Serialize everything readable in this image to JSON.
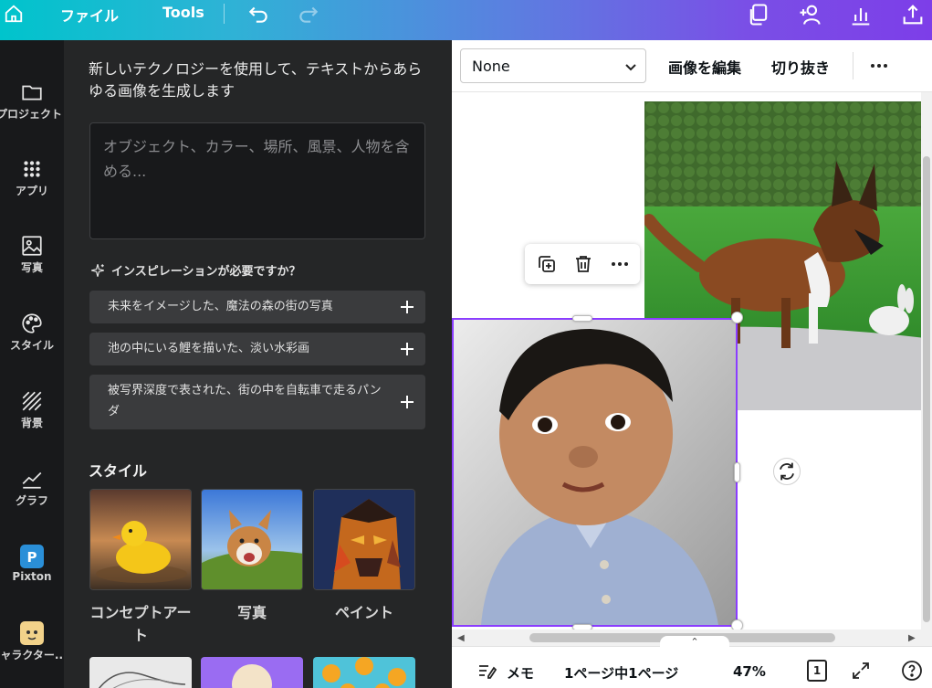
{
  "topbar": {
    "menu_file": "ファイル",
    "menu_tools": "Tools"
  },
  "rail": {
    "items": [
      {
        "label": "プロジェクト",
        "icon": "folder-icon"
      },
      {
        "label": "アプリ",
        "icon": "apps-grid-icon"
      },
      {
        "label": "写真",
        "icon": "photo-icon"
      },
      {
        "label": "スタイル",
        "icon": "palette-icon"
      },
      {
        "label": "背景",
        "icon": "background-icon"
      },
      {
        "label": "グラフ",
        "icon": "chart-icon"
      },
      {
        "label": "Pixton",
        "icon": "pixton-icon"
      },
      {
        "label": "キャラクター...",
        "icon": "character-icon"
      }
    ]
  },
  "panel": {
    "heading": "新しいテクノロジーを使用して、テキストからあらゆる画像を生成します",
    "prompt_placeholder": "オブジェクト、カラー、場所、風景、人物を含める...",
    "inspiration_heading": "インスピレーションが必要ですか？",
    "suggestions": [
      "未来をイメージした、魔法の森の街の写真",
      "池の中にいる鯉を描いた、淡い水彩画",
      "被写界深度で表された、街の中を自転車で走るパンダ"
    ],
    "style_title": "スタイル",
    "styles": [
      {
        "label": "コンセプトアート"
      },
      {
        "label": "写真"
      },
      {
        "label": "ペイント"
      }
    ]
  },
  "context_toolbar": {
    "select_value": "None",
    "edit_image": "画像を編集",
    "crop": "切り抜き"
  },
  "footer": {
    "notes": "メモ",
    "page_indicator": "1ページ中1ページ",
    "zoom": "47%",
    "page_count": "1"
  },
  "colors": {
    "accent": "#8b3dff",
    "panel_bg": "#252627",
    "rail_bg": "#18191b"
  }
}
